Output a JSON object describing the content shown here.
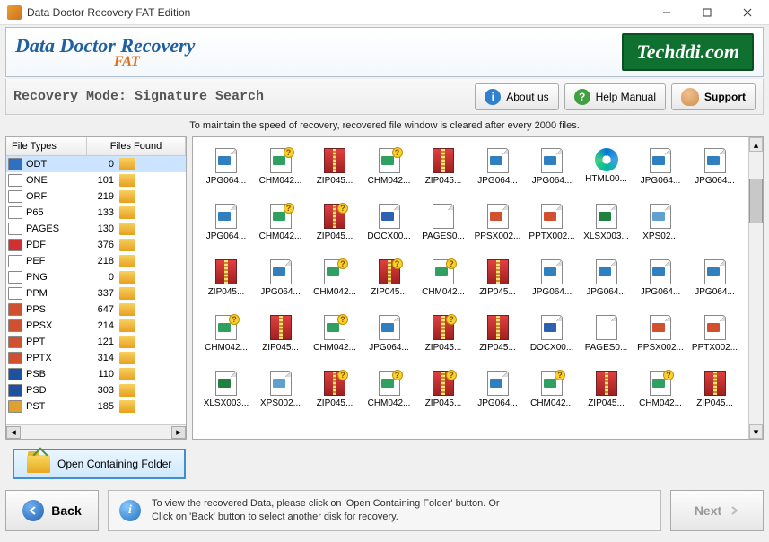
{
  "window": {
    "title": "Data Doctor Recovery FAT Edition"
  },
  "header": {
    "brand": "Data Doctor Recovery",
    "sub": "FAT",
    "vendor": "Techddi.com"
  },
  "toolbar": {
    "mode": "Recovery Mode: Signature Search",
    "about": "About us",
    "help": "Help Manual",
    "support": "Support"
  },
  "info_strip": "To maintain the speed of recovery, recovered file window is cleared after every 2000 files.",
  "file_types": {
    "col1": "File Types",
    "col2": "Files Found",
    "rows": [
      {
        "ext": "ODT",
        "count": 0,
        "color": "#3070c0"
      },
      {
        "ext": "ONE",
        "count": 101,
        "color": "#ffffff"
      },
      {
        "ext": "ORF",
        "count": 219,
        "color": "#ffffff"
      },
      {
        "ext": "P65",
        "count": 133,
        "color": "#ffffff"
      },
      {
        "ext": "PAGES",
        "count": 130,
        "color": "#ffffff"
      },
      {
        "ext": "PDF",
        "count": 376,
        "color": "#d03030"
      },
      {
        "ext": "PEF",
        "count": 218,
        "color": "#ffffff"
      },
      {
        "ext": "PNG",
        "count": 0,
        "color": "#ffffff"
      },
      {
        "ext": "PPM",
        "count": 337,
        "color": "#ffffff"
      },
      {
        "ext": "PPS",
        "count": 647,
        "color": "#d05030"
      },
      {
        "ext": "PPSX",
        "count": 214,
        "color": "#d05030"
      },
      {
        "ext": "PPT",
        "count": 121,
        "color": "#d05030"
      },
      {
        "ext": "PPTX",
        "count": 314,
        "color": "#d05030"
      },
      {
        "ext": "PSB",
        "count": 110,
        "color": "#2050a0"
      },
      {
        "ext": "PSD",
        "count": 303,
        "color": "#2050a0"
      },
      {
        "ext": "PST",
        "count": 185,
        "color": "#e0a030"
      }
    ]
  },
  "open_folder": "Open Containing Folder",
  "files": [
    {
      "label": "JPG064...",
      "t": "page",
      "bc": "#3080c0"
    },
    {
      "label": "CHM042...",
      "t": "page",
      "bc": "#30a060",
      "q": 1
    },
    {
      "label": "ZIP045...",
      "t": "zip"
    },
    {
      "label": "CHM042...",
      "t": "page",
      "bc": "#30a060",
      "q": 1
    },
    {
      "label": "ZIP045...",
      "t": "zip"
    },
    {
      "label": "JPG064...",
      "t": "page",
      "bc": "#3080c0"
    },
    {
      "label": "JPG064...",
      "t": "page",
      "bc": "#3080c0"
    },
    {
      "label": "HTML00...",
      "t": "edge"
    },
    {
      "label": "JPG064...",
      "t": "page",
      "bc": "#3080c0"
    },
    {
      "label": "JPG064...",
      "t": "page",
      "bc": "#3080c0"
    },
    {
      "label": "JPG064...",
      "t": "page",
      "bc": "#3080c0"
    },
    {
      "label": "CHM042...",
      "t": "page",
      "bc": "#30a060",
      "q": 1
    },
    {
      "label": "ZIP045...",
      "t": "zip",
      "q": 1
    },
    {
      "label": "DOCX00...",
      "t": "page",
      "bc": "#3060b0"
    },
    {
      "label": "PAGES0...",
      "t": "page",
      "bc": "#ffffff"
    },
    {
      "label": "PPSX002...",
      "t": "page",
      "bc": "#d05030"
    },
    {
      "label": "PPTX002...",
      "t": "page",
      "bc": "#d05030"
    },
    {
      "label": "XLSX003...",
      "t": "page",
      "bc": "#208040"
    },
    {
      "label": "XPS02...",
      "t": "page",
      "bc": "#60a0d0"
    },
    {
      "label": "",
      "t": "blank"
    },
    {
      "label": "ZIP045...",
      "t": "zip"
    },
    {
      "label": "JPG064...",
      "t": "page",
      "bc": "#3080c0"
    },
    {
      "label": "CHM042...",
      "t": "page",
      "bc": "#30a060",
      "q": 1
    },
    {
      "label": "ZIP045...",
      "t": "zip",
      "q": 1
    },
    {
      "label": "CHM042...",
      "t": "page",
      "bc": "#30a060",
      "q": 1
    },
    {
      "label": "ZIP045...",
      "t": "zip"
    },
    {
      "label": "JPG064...",
      "t": "page",
      "bc": "#3080c0"
    },
    {
      "label": "JPG064...",
      "t": "page",
      "bc": "#3080c0"
    },
    {
      "label": "JPG064...",
      "t": "page",
      "bc": "#3080c0"
    },
    {
      "label": "JPG064...",
      "t": "page",
      "bc": "#3080c0"
    },
    {
      "label": "CHM042...",
      "t": "page",
      "bc": "#30a060",
      "q": 1
    },
    {
      "label": "ZIP045...",
      "t": "zip"
    },
    {
      "label": "CHM042...",
      "t": "page",
      "bc": "#30a060",
      "q": 1
    },
    {
      "label": "JPG064...",
      "t": "page",
      "bc": "#3080c0"
    },
    {
      "label": "ZIP045...",
      "t": "zip",
      "q": 1
    },
    {
      "label": "ZIP045...",
      "t": "zip"
    },
    {
      "label": "DOCX00...",
      "t": "page",
      "bc": "#3060b0"
    },
    {
      "label": "PAGES0...",
      "t": "page",
      "bc": "#ffffff"
    },
    {
      "label": "PPSX002...",
      "t": "page",
      "bc": "#d05030"
    },
    {
      "label": "PPTX002...",
      "t": "page",
      "bc": "#d05030"
    },
    {
      "label": "XLSX003...",
      "t": "page",
      "bc": "#208040"
    },
    {
      "label": "XPS002...",
      "t": "page",
      "bc": "#60a0d0"
    },
    {
      "label": "ZIP045...",
      "t": "zip",
      "q": 1
    },
    {
      "label": "CHM042...",
      "t": "page",
      "bc": "#30a060",
      "q": 1
    },
    {
      "label": "ZIP045...",
      "t": "zip",
      "q": 1
    },
    {
      "label": "JPG064...",
      "t": "page",
      "bc": "#3080c0"
    },
    {
      "label": "CHM042...",
      "t": "page",
      "bc": "#30a060",
      "q": 1
    },
    {
      "label": "ZIP045...",
      "t": "zip"
    },
    {
      "label": "CHM042...",
      "t": "page",
      "bc": "#30a060",
      "q": 1
    },
    {
      "label": "ZIP045...",
      "t": "zip"
    }
  ],
  "hint": {
    "line1": "To view the recovered Data, please click on 'Open Containing Folder' button. Or",
    "line2": "Click on 'Back' button to select another disk for recovery."
  },
  "nav": {
    "back": "Back",
    "next": "Next"
  }
}
